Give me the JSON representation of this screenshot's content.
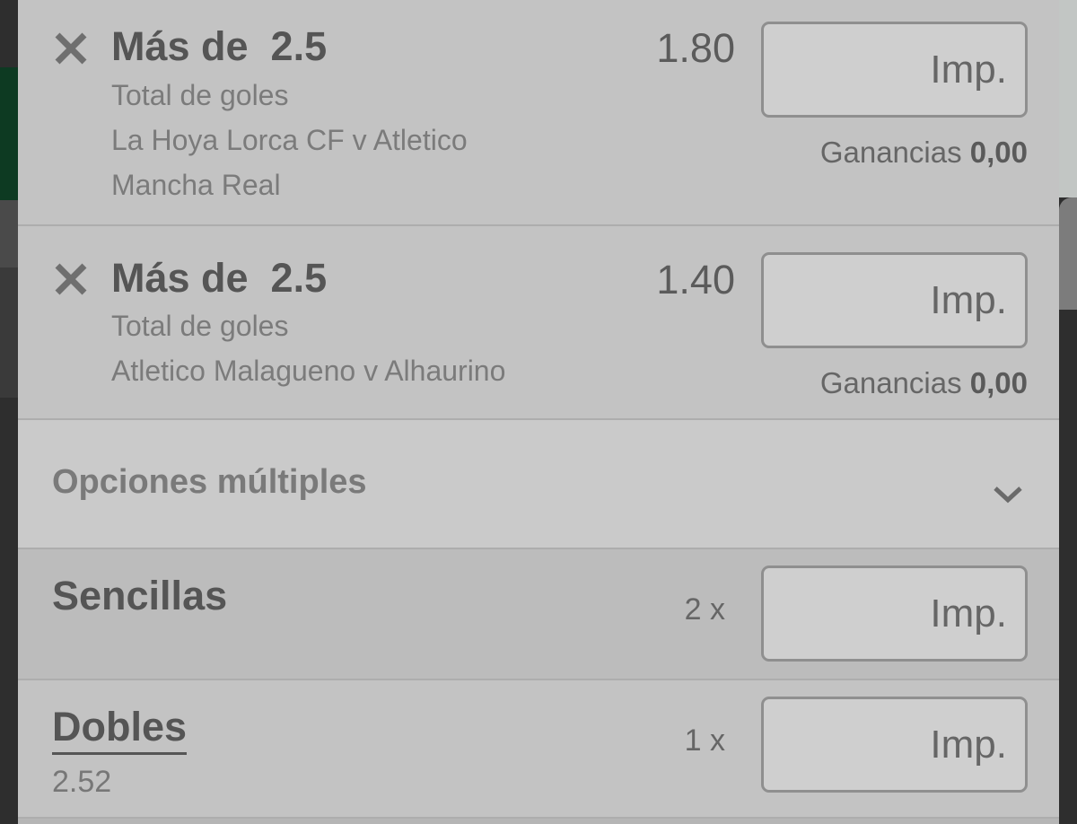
{
  "selections": [
    {
      "title": "Más de  2.5",
      "market": "Total de goles",
      "event_lines": [
        "La Hoya Lorca CF v Atletico",
        "Mancha Real"
      ],
      "odds": "1.80",
      "stake_placeholder": "Imp.",
      "winnings_label": "Ganancias",
      "winnings_value": "0,00"
    },
    {
      "title": "Más de  2.5",
      "market": "Total de goles",
      "event_lines": [
        "Atletico Malagueno v Alhaurino"
      ],
      "odds": "1.40",
      "stake_placeholder": "Imp.",
      "winnings_label": "Ganancias",
      "winnings_value": "0,00"
    }
  ],
  "multiple_options": {
    "label": "Opciones múltiples"
  },
  "bet_types": [
    {
      "title": "Sencillas",
      "count": "2 x",
      "stake_placeholder": "Imp."
    },
    {
      "title": "Dobles",
      "odds": "2.52",
      "count": "1 x",
      "stake_placeholder": "Imp."
    }
  ],
  "icons": {
    "remove": "close-icon",
    "expand": "chevron-down-icon"
  },
  "colors": {
    "panel_bg": "#c3c3c3",
    "text_dark": "#555555",
    "text_muted": "#7b7b7b"
  }
}
